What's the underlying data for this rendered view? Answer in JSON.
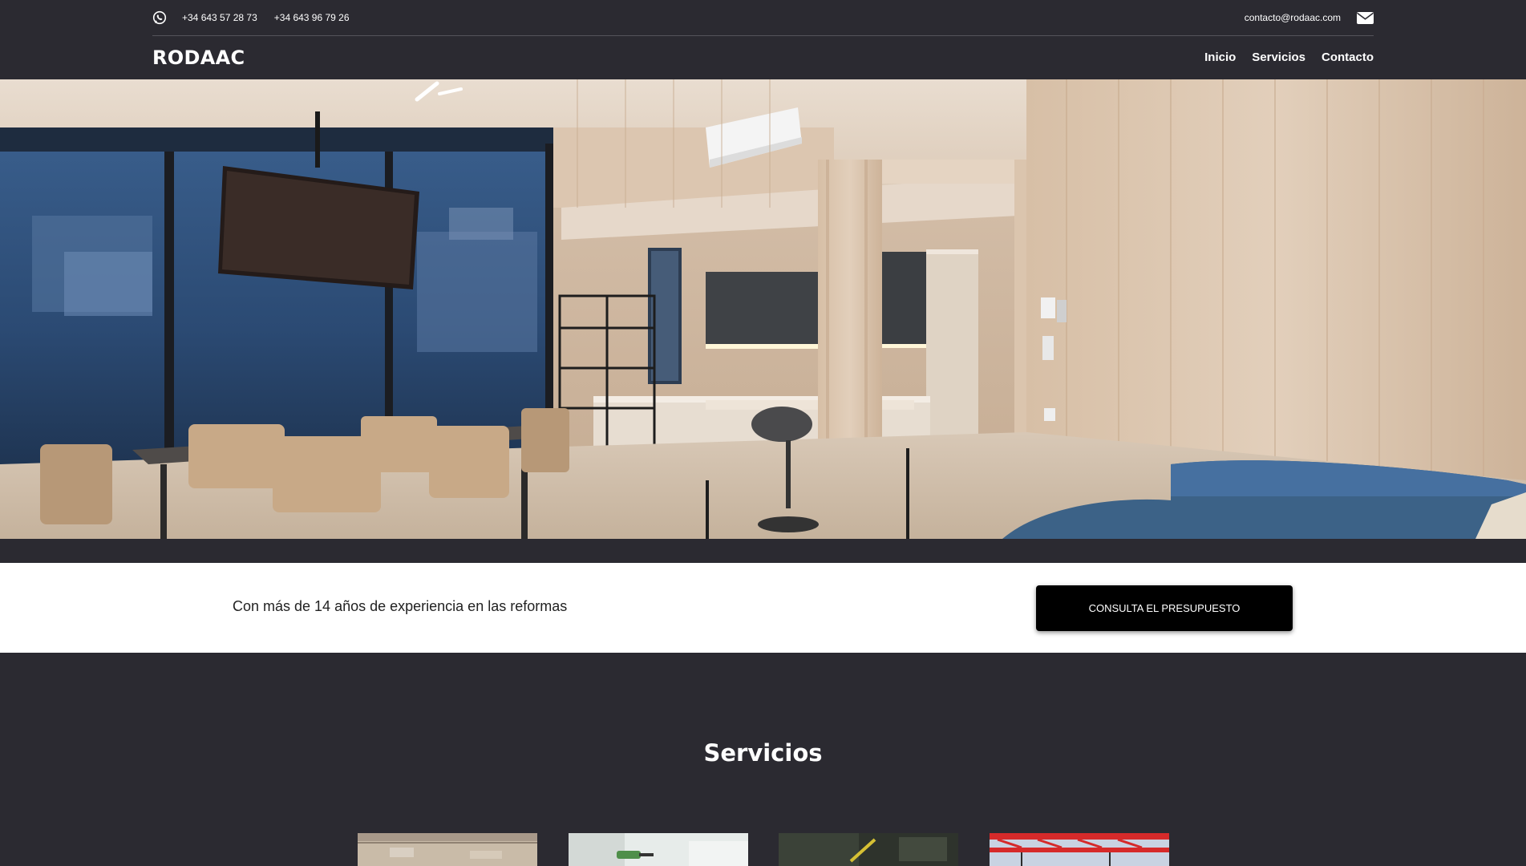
{
  "topbar": {
    "whatsapp_icon": "whatsapp-icon",
    "phones": [
      "+34 643 57 28 73",
      "+34 643 96 79 26"
    ],
    "email": "contacto@rodaac.com",
    "mail_icon": "envelope-icon"
  },
  "header": {
    "logo": "RODAAC",
    "nav": [
      "Inicio",
      "Servicios",
      "Contacto"
    ]
  },
  "hero": {
    "image": "modern-open-kitchen-dining-room-interior"
  },
  "cta": {
    "text": "Con más de 14 años de experiencia en las reformas",
    "button_label": "CONSULTA EL PRESUPUESTO"
  },
  "services": {
    "title": "Servicios",
    "cards": [
      {
        "image": "ceiling-renovation-photo"
      },
      {
        "image": "drill-wall-work-photo"
      },
      {
        "image": "garden-tool-photo"
      },
      {
        "image": "red-steel-structure-photo"
      }
    ]
  },
  "colors": {
    "header_bg": "#2b2a31",
    "page_bg": "#2b2a31",
    "cta_bg": "#ffffff",
    "button_bg": "#000000"
  }
}
